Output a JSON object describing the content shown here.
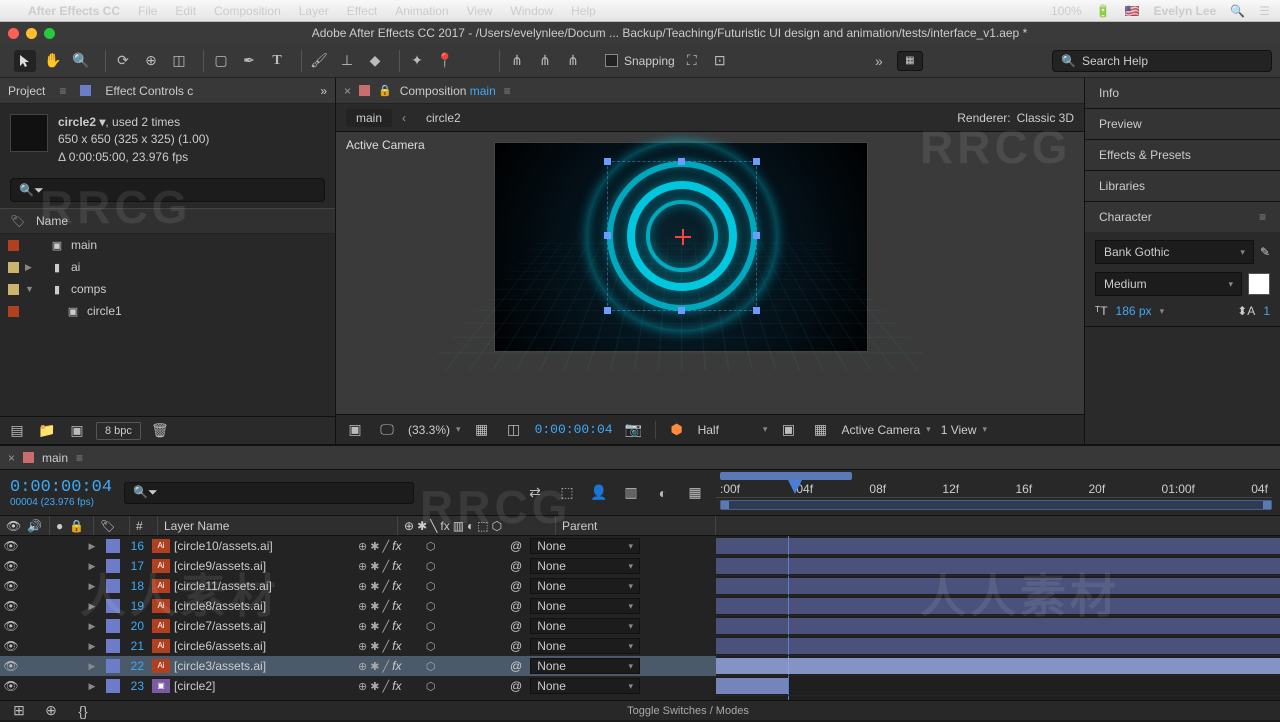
{
  "mac_menu": {
    "app": "After Effects CC",
    "items": [
      "File",
      "Edit",
      "Composition",
      "Layer",
      "Effect",
      "Animation",
      "View",
      "Window",
      "Help"
    ],
    "battery": "100% ",
    "user": "Evelyn Lee"
  },
  "title": "Adobe After Effects CC 2017 - /Users/evelynlee/Docum ... Backup/Teaching/Futuristic UI design and animation/tests/interface_v1.aep *",
  "snapping_label": "Snapping",
  "search_help_placeholder": "Search Help",
  "project": {
    "tab": "Project",
    "effect_tab": "Effect Controls c",
    "item_name": "circle2 ▾",
    "uses": ", used 2 times",
    "dims": "650 x 650  (325 x 325) (1.00)",
    "duration": "Δ 0:00:05:00, 23.976 fps",
    "col_name": "Name",
    "items": [
      {
        "swatch": "#b04020",
        "tw": "",
        "icon": "▣",
        "label": "main",
        "indent": 0
      },
      {
        "swatch": "#c9b56d",
        "tw": "▶",
        "icon": "▮",
        "label": "ai",
        "indent": 0
      },
      {
        "swatch": "#c9b56d",
        "tw": "▼",
        "icon": "▮",
        "label": "comps",
        "indent": 0
      },
      {
        "swatch": "#b04020",
        "tw": "",
        "icon": "▣",
        "label": "circle1",
        "indent": 1
      }
    ],
    "bpc": "8 bpc"
  },
  "comp": {
    "prefix": "Composition",
    "name": "main",
    "crumbs": [
      "main",
      "circle2"
    ],
    "renderer_label": "Renderer:",
    "renderer": "Classic 3D",
    "cam": "Active Camera",
    "magnification": "(33.3%)",
    "timecode": "0:00:00:04",
    "resolution": "Half",
    "view_mode": "Active Camera",
    "views": "1 View"
  },
  "right": {
    "sections": [
      "Info",
      "Preview",
      "Effects & Presets",
      "Libraries",
      "Character"
    ],
    "font": "Bank Gothic",
    "weight": "Medium",
    "font_size": "186 px",
    "leading_val": "1"
  },
  "timeline": {
    "tab": "main",
    "time": "0:00:00:04",
    "frame_info": "00004 (23.976 fps)",
    "ruler": [
      ":00f",
      "04f",
      "08f",
      "12f",
      "16f",
      "20f",
      "01:00f",
      "04f"
    ],
    "col_num": "#",
    "col_layer": "Layer Name",
    "col_parent": "Parent",
    "layers": [
      {
        "n": 16,
        "name": "[circle10/assets.ai]",
        "sel": false,
        "parent": "None",
        "src": "ai"
      },
      {
        "n": 17,
        "name": "[circle9/assets.ai]",
        "sel": false,
        "parent": "None",
        "src": "ai"
      },
      {
        "n": 18,
        "name": "[circle11/assets.ai]",
        "sel": false,
        "parent": "None",
        "src": "ai"
      },
      {
        "n": 19,
        "name": "[circle8/assets.ai]",
        "sel": false,
        "parent": "None",
        "src": "ai"
      },
      {
        "n": 20,
        "name": "[circle7/assets.ai]",
        "sel": false,
        "parent": "None",
        "src": "ai"
      },
      {
        "n": 21,
        "name": "[circle6/assets.ai]",
        "sel": false,
        "parent": "None",
        "src": "ai"
      },
      {
        "n": 22,
        "name": "[circle3/assets.ai]",
        "sel": true,
        "parent": "None",
        "src": "ai"
      },
      {
        "n": 23,
        "name": "[circle2]",
        "sel": false,
        "parent": "None",
        "src": "comp"
      }
    ],
    "toggle": "Toggle Switches / Modes"
  },
  "colors": {
    "traffic": [
      "#ff5f56",
      "#ffbd2e",
      "#27c93f"
    ]
  }
}
